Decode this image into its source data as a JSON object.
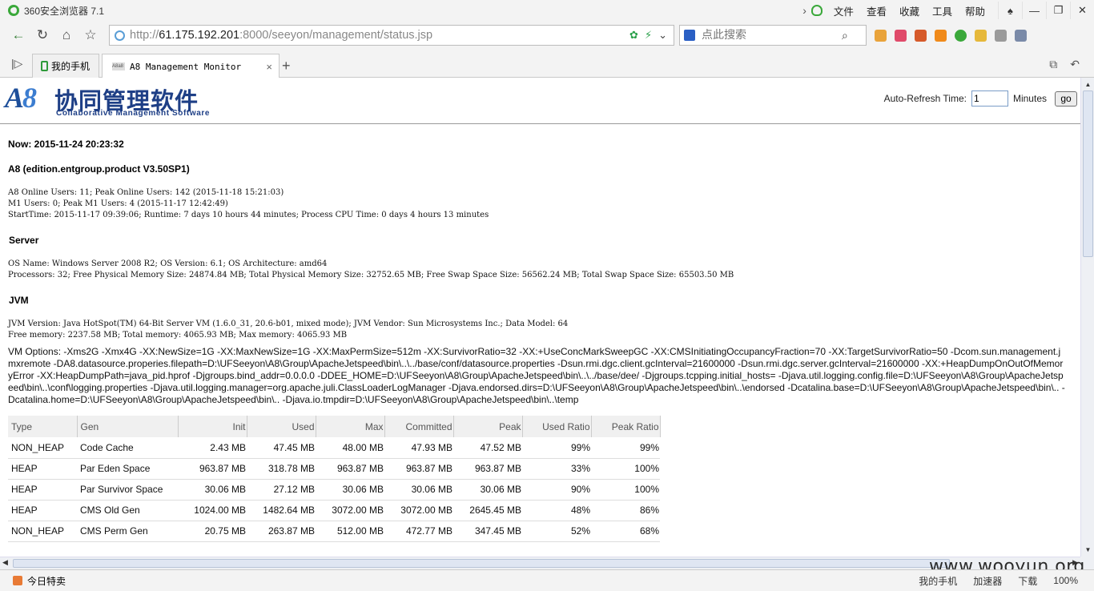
{
  "browser": {
    "app_title": "360安全浏览器 7.1",
    "menu": [
      "文件",
      "查看",
      "收藏",
      "工具",
      "帮助"
    ],
    "url_host": "61.175.192.201",
    "url_prefix": "http://",
    "url_rest": ":8000/seeyon/management/status.jsp",
    "search_placeholder": "点此搜索",
    "tabs": [
      {
        "label": "我的手机"
      },
      {
        "label": "A8 Management Monitor",
        "favicon_text": "A8a8"
      }
    ],
    "status_left": "今日特卖",
    "status_items": [
      "我的手机",
      "加速器",
      "下载",
      "100%"
    ]
  },
  "page": {
    "brand_cn": "协同管理软件",
    "brand_en": "Collaborative Management Software",
    "refresh_label": "Auto-Refresh Time:",
    "refresh_value": "1",
    "refresh_unit": "Minutes",
    "go_label": "go",
    "now": "Now: 2015-11-24 20:23:32",
    "edition": "A8 (edition.entgroup.product V3.50SP1)",
    "info_lines": [
      "A8 Online Users: 11; Peak Online Users: 142 (2015-11-18 15:21:03)",
      "M1 Users: 0; Peak M1 Users: 4 (2015-11-17 12:42:49)",
      "StartTime: 2015-11-17 09:39:06; Runtime: 7 days 10 hours 44 minutes; Process CPU Time: 0 days 4 hours 13 minutes"
    ],
    "server_title": "Server",
    "server_lines": [
      "OS Name: Windows Server 2008 R2; OS Version: 6.1; OS Architecture: amd64",
      "Processors: 32; Free Physical Memory Size: 24874.84 MB; Total Physical Memory Size: 32752.65 MB; Free Swap Space Size: 56562.24 MB; Total Swap Space Size: 65503.50 MB"
    ],
    "jvm_title": "JVM",
    "jvm_lines": [
      "JVM Version: Java HotSpot(TM) 64-Bit Server VM (1.6.0_31, 20.6-b01, mixed mode); JVM Vendor: Sun Microsystems Inc.; Data Model: 64",
      "Free memory: 2237.58 MB; Total memory: 4065.93 MB; Max memory: 4065.93 MB"
    ],
    "vm_options": "VM Options: -Xms2G -Xmx4G -XX:NewSize=1G -XX:MaxNewSize=1G -XX:MaxPermSize=512m -XX:SurvivorRatio=32 -XX:+UseConcMarkSweepGC -XX:CMSInitiatingOccupancyFraction=70 -XX:TargetSurvivorRatio=50 -Dcom.sun.management.jmxremote -DA8.datasource.properies.filepath=D:\\UFSeeyon\\A8\\Group\\ApacheJetspeed\\bin\\..\\../base/conf/datasource.properties -Dsun.rmi.dgc.client.gcInterval=21600000 -Dsun.rmi.dgc.server.gcInterval=21600000 -XX:+HeapDumpOnOutOfMemoryError -XX:HeapDumpPath=java_pid.hprof -Djgroups.bind_addr=0.0.0.0 -DDEE_HOME=D:\\UFSeeyon\\A8\\Group\\ApacheJetspeed\\bin\\..\\../base/dee/ -Djgroups.tcpping.initial_hosts= -Djava.util.logging.config.file=D:\\UFSeeyon\\A8\\Group\\ApacheJetspeed\\bin\\..\\conf\\logging.properties -Djava.util.logging.manager=org.apache.juli.ClassLoaderLogManager -Djava.endorsed.dirs=D:\\UFSeeyon\\A8\\Group\\ApacheJetspeed\\bin\\..\\endorsed -Dcatalina.base=D:\\UFSeeyon\\A8\\Group\\ApacheJetspeed\\bin\\.. -Dcatalina.home=D:\\UFSeeyon\\A8\\Group\\ApacheJetspeed\\bin\\.. -Djava.io.tmpdir=D:\\UFSeeyon\\A8\\Group\\ApacheJetspeed\\bin\\..\\temp",
    "table_headers": [
      "Type",
      "Gen",
      "Init",
      "Used",
      "Max",
      "Committed",
      "Peak",
      "Used Ratio",
      "Peak Ratio"
    ],
    "table_rows": [
      [
        "NON_HEAP",
        "Code Cache",
        "2.43 MB",
        "47.45 MB",
        "48.00 MB",
        "47.93 MB",
        "47.52 MB",
        "99%",
        "99%"
      ],
      [
        "HEAP",
        "Par Eden Space",
        "963.87 MB",
        "318.78 MB",
        "963.87 MB",
        "963.87 MB",
        "963.87 MB",
        "33%",
        "100%"
      ],
      [
        "HEAP",
        "Par Survivor Space",
        "30.06 MB",
        "27.12 MB",
        "30.06 MB",
        "30.06 MB",
        "30.06 MB",
        "90%",
        "100%"
      ],
      [
        "HEAP",
        "CMS Old Gen",
        "1024.00 MB",
        "1482.64 MB",
        "3072.00 MB",
        "3072.00 MB",
        "2645.45 MB",
        "48%",
        "86%"
      ],
      [
        "NON_HEAP",
        "CMS Perm Gen",
        "20.75 MB",
        "263.87 MB",
        "512.00 MB",
        "472.77 MB",
        "347.45 MB",
        "52%",
        "68%"
      ]
    ]
  },
  "watermark": "www.wooyun.org"
}
